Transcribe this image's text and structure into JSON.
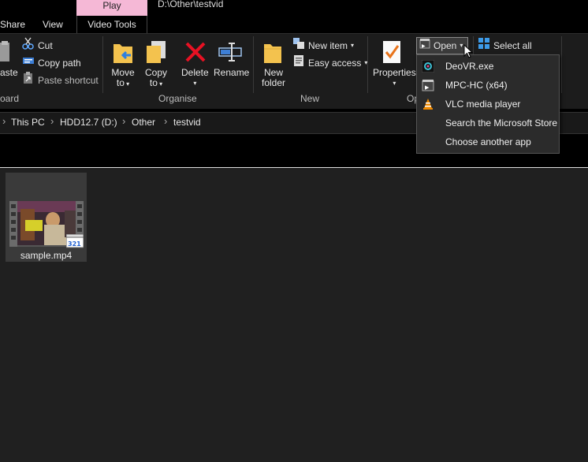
{
  "window": {
    "contextual_tab": "Play",
    "path": "D:\\Other\\testvid",
    "tabs": [
      "Share",
      "View",
      "Video Tools"
    ]
  },
  "ribbon": {
    "clipboard": {
      "paste_label": "aste",
      "cut_label": "Cut",
      "copy_path_label": "Copy path",
      "paste_shortcut_label": "Paste shortcut",
      "group_label": "oard"
    },
    "organise": {
      "move_to": [
        "Move",
        "to"
      ],
      "copy_to": [
        "Copy",
        "to"
      ],
      "delete_label": "Delete",
      "rename_label": "Rename",
      "group_label": "Organise"
    },
    "new": {
      "new_folder": [
        "New",
        "folder"
      ],
      "new_item_label": "New item",
      "easy_access_label": "Easy access",
      "group_label": "New"
    },
    "open": {
      "properties_label": "Properties",
      "open_label": "Open",
      "group_label": "Op"
    },
    "select": {
      "select_all_label": "Select all"
    }
  },
  "breadcrumb": [
    "This PC",
    "HDD12.7 (D:)",
    "Other",
    "testvid"
  ],
  "files": [
    {
      "name": "sample.mp4"
    }
  ],
  "open_menu": {
    "items": [
      {
        "label": "DeoVR.exe",
        "icon": "deovr-icon"
      },
      {
        "label": "MPC-HC (x64)",
        "icon": "mpc-hc-icon"
      },
      {
        "label": "VLC media player",
        "icon": "vlc-icon"
      },
      {
        "label": "Search the Microsoft Store",
        "icon": ""
      },
      {
        "label": "Choose another app",
        "icon": ""
      }
    ]
  },
  "colors": {
    "contextual_tab_bg": "#f5b8d6",
    "background": "#202020",
    "ribbon_bg": "#1c1c1c",
    "menu_bg": "#2b2b2b"
  }
}
